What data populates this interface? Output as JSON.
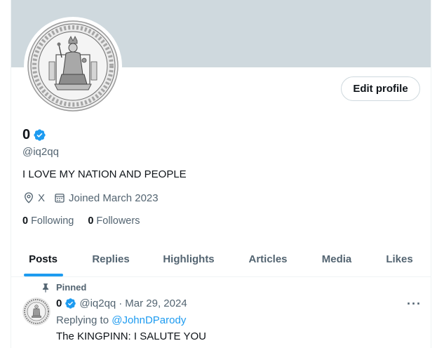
{
  "profile": {
    "display_name": "0",
    "handle": "@iq2qq",
    "bio": "I LOVE MY NATION AND PEOPLE",
    "location": "X",
    "joined": "Joined March 2023",
    "following_count": "0",
    "following_label": "Following",
    "followers_count": "0",
    "followers_label": "Followers",
    "edit_label": "Edit profile",
    "avatar_icon": "royal-seal-avatar",
    "verified_icon": "verified-badge-icon"
  },
  "colors": {
    "accent": "#1d9bf0",
    "banner": "#cfd9de",
    "secondary_text": "#536471",
    "primary_text": "#0f1419"
  },
  "tabs": [
    {
      "label": "Posts",
      "active": true
    },
    {
      "label": "Replies",
      "active": false
    },
    {
      "label": "Highlights",
      "active": false
    },
    {
      "label": "Articles",
      "active": false
    },
    {
      "label": "Media",
      "active": false
    },
    {
      "label": "Likes",
      "active": false
    }
  ],
  "post": {
    "pinned_label": "Pinned",
    "author_name": "0",
    "author_handle": "@iq2qq",
    "separator": "·",
    "date": "Mar 29, 2024",
    "replying_prefix": "Replying to",
    "replying_to": "@JohnDParody",
    "text": "The KINGPINN: I SALUTE YOU",
    "more_icon": "more-options-icon"
  }
}
